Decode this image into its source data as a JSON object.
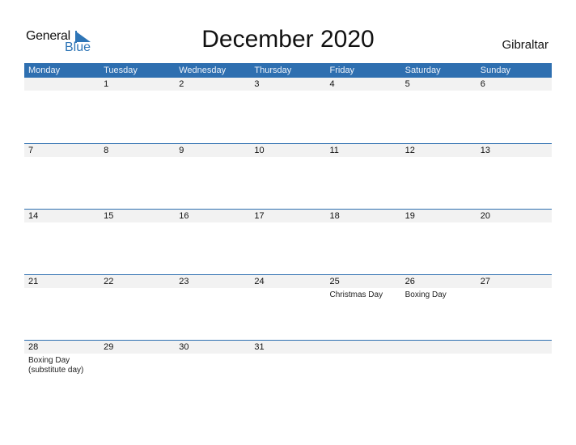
{
  "logo": {
    "word1": "General",
    "word2": "Blue"
  },
  "title": "December 2020",
  "region": "Gibraltar",
  "weekdays": [
    "Monday",
    "Tuesday",
    "Wednesday",
    "Thursday",
    "Friday",
    "Saturday",
    "Sunday"
  ],
  "weeks": [
    {
      "days": [
        {
          "num": "",
          "holiday": ""
        },
        {
          "num": "1",
          "holiday": ""
        },
        {
          "num": "2",
          "holiday": ""
        },
        {
          "num": "3",
          "holiday": ""
        },
        {
          "num": "4",
          "holiday": ""
        },
        {
          "num": "5",
          "holiday": ""
        },
        {
          "num": "6",
          "holiday": ""
        }
      ]
    },
    {
      "days": [
        {
          "num": "7",
          "holiday": ""
        },
        {
          "num": "8",
          "holiday": ""
        },
        {
          "num": "9",
          "holiday": ""
        },
        {
          "num": "10",
          "holiday": ""
        },
        {
          "num": "11",
          "holiday": ""
        },
        {
          "num": "12",
          "holiday": ""
        },
        {
          "num": "13",
          "holiday": ""
        }
      ]
    },
    {
      "days": [
        {
          "num": "14",
          "holiday": ""
        },
        {
          "num": "15",
          "holiday": ""
        },
        {
          "num": "16",
          "holiday": ""
        },
        {
          "num": "17",
          "holiday": ""
        },
        {
          "num": "18",
          "holiday": ""
        },
        {
          "num": "19",
          "holiday": ""
        },
        {
          "num": "20",
          "holiday": ""
        }
      ]
    },
    {
      "days": [
        {
          "num": "21",
          "holiday": ""
        },
        {
          "num": "22",
          "holiday": ""
        },
        {
          "num": "23",
          "holiday": ""
        },
        {
          "num": "24",
          "holiday": ""
        },
        {
          "num": "25",
          "holiday": "Christmas Day"
        },
        {
          "num": "26",
          "holiday": "Boxing Day"
        },
        {
          "num": "27",
          "holiday": ""
        }
      ]
    },
    {
      "days": [
        {
          "num": "28",
          "holiday": "Boxing Day (substitute day)"
        },
        {
          "num": "29",
          "holiday": ""
        },
        {
          "num": "30",
          "holiday": ""
        },
        {
          "num": "31",
          "holiday": ""
        },
        {
          "num": "",
          "holiday": ""
        },
        {
          "num": "",
          "holiday": ""
        },
        {
          "num": "",
          "holiday": ""
        }
      ]
    }
  ],
  "colors": {
    "accent": "#2e6fb0",
    "strip": "#f2f2f2"
  }
}
